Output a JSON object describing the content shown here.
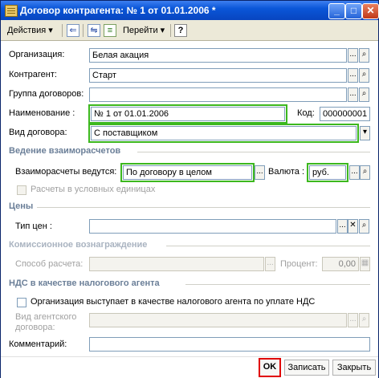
{
  "window": {
    "title": "Договор контрагента: № 1 от 01.01.2006 *"
  },
  "titlebar": {
    "min": "_",
    "max": "□",
    "close": "✕"
  },
  "toolbar": {
    "actions": "Действия",
    "goto": "Перейти",
    "help": "?",
    "dd": "▾"
  },
  "form": {
    "org_label": "Организация:",
    "org_value": "Белая акация",
    "contractor_label": "Контрагент:",
    "contractor_value": "Старт",
    "group_label": "Группа договоров:",
    "group_value": "",
    "name_label": "Наименование :",
    "name_value": "№ 1 от 01.01.2006",
    "code_label": "Код:",
    "code_value": "000000001",
    "kind_label": "Вид договора:",
    "kind_value": "С поставщиком",
    "settle_section": "Ведение взаиморасчетов",
    "settle_label": "Взаиморасчеты ведутся:",
    "settle_value": "По договору в целом",
    "currency_label": "Валюта :",
    "currency_value": "руб.",
    "conv_units_label": "Расчеты в условных единицах",
    "prices_section": "Цены",
    "price_type_label": "Тип цен :",
    "price_type_value": "",
    "commission_section": "Комиссионное вознаграждение",
    "calc_method_label": "Способ расчета:",
    "percent_label": "Процент:",
    "percent_value": "0,00",
    "vat_section": "НДС в качестве налогового агента",
    "vat_agent_label": "Организация выступает в качестве налогового агента по уплате НДС",
    "agent_contract_label_1": "Вид агентского",
    "agent_contract_label_2": "договора:",
    "comment_label": "Комментарий:",
    "comment_value": ""
  },
  "buttons": {
    "ok": "OK",
    "save": "Записать",
    "close": "Закрыть"
  },
  "glyphs": {
    "ellipsis": "...",
    "search": "🔍",
    "clear": "✕",
    "dropdown": "▾",
    "calc": "▦"
  }
}
